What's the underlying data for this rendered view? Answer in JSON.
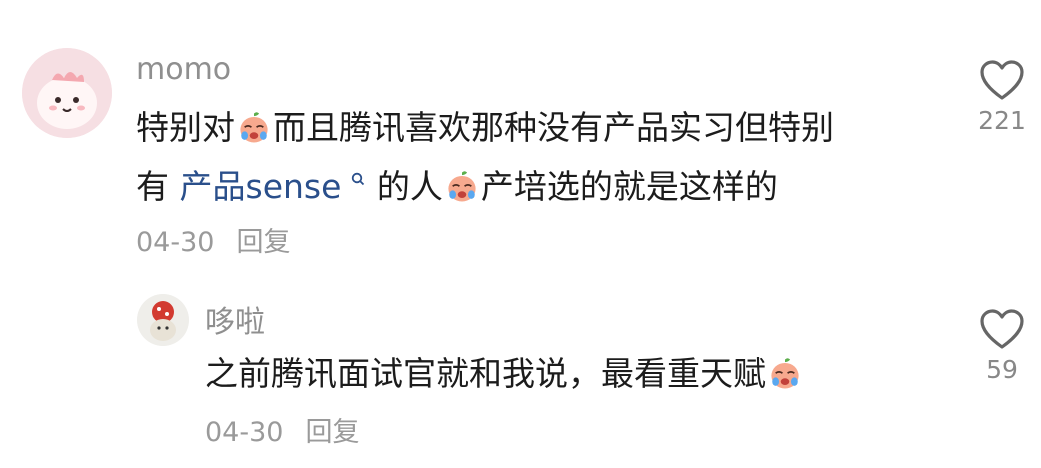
{
  "comments": [
    {
      "username": "momo",
      "text_lines": [
        [
          "特别对",
          "emoji:cry",
          "而且腾讯喜欢那种没有产品实习但特别"
        ],
        [
          "有 ",
          "link",
          "emoji:cry",
          "产培选的就是这样的"
        ]
      ],
      "text_part1": "特别对",
      "text_part2": "而且腾讯喜欢那种没有产品实习但特别",
      "text_part3": "有 ",
      "link_text": "产品sense",
      "text_part4": "的人",
      "text_part5": "产培选的就是这样的",
      "date": "04-30",
      "reply_label": "回复",
      "like_count": "221"
    },
    {
      "username": "哆啦",
      "text_part1": "之前腾讯面试官就和我说，最看重天赋",
      "date": "04-30",
      "reply_label": "回复",
      "like_count": "59"
    }
  ],
  "icons": {
    "like": "heart-outline-icon",
    "emoji": "crying-face-emoji",
    "search": "search-icon"
  },
  "colors": {
    "link": "#2a4f8b",
    "meta": "#9a9a9a",
    "username": "#8f8f8f"
  }
}
